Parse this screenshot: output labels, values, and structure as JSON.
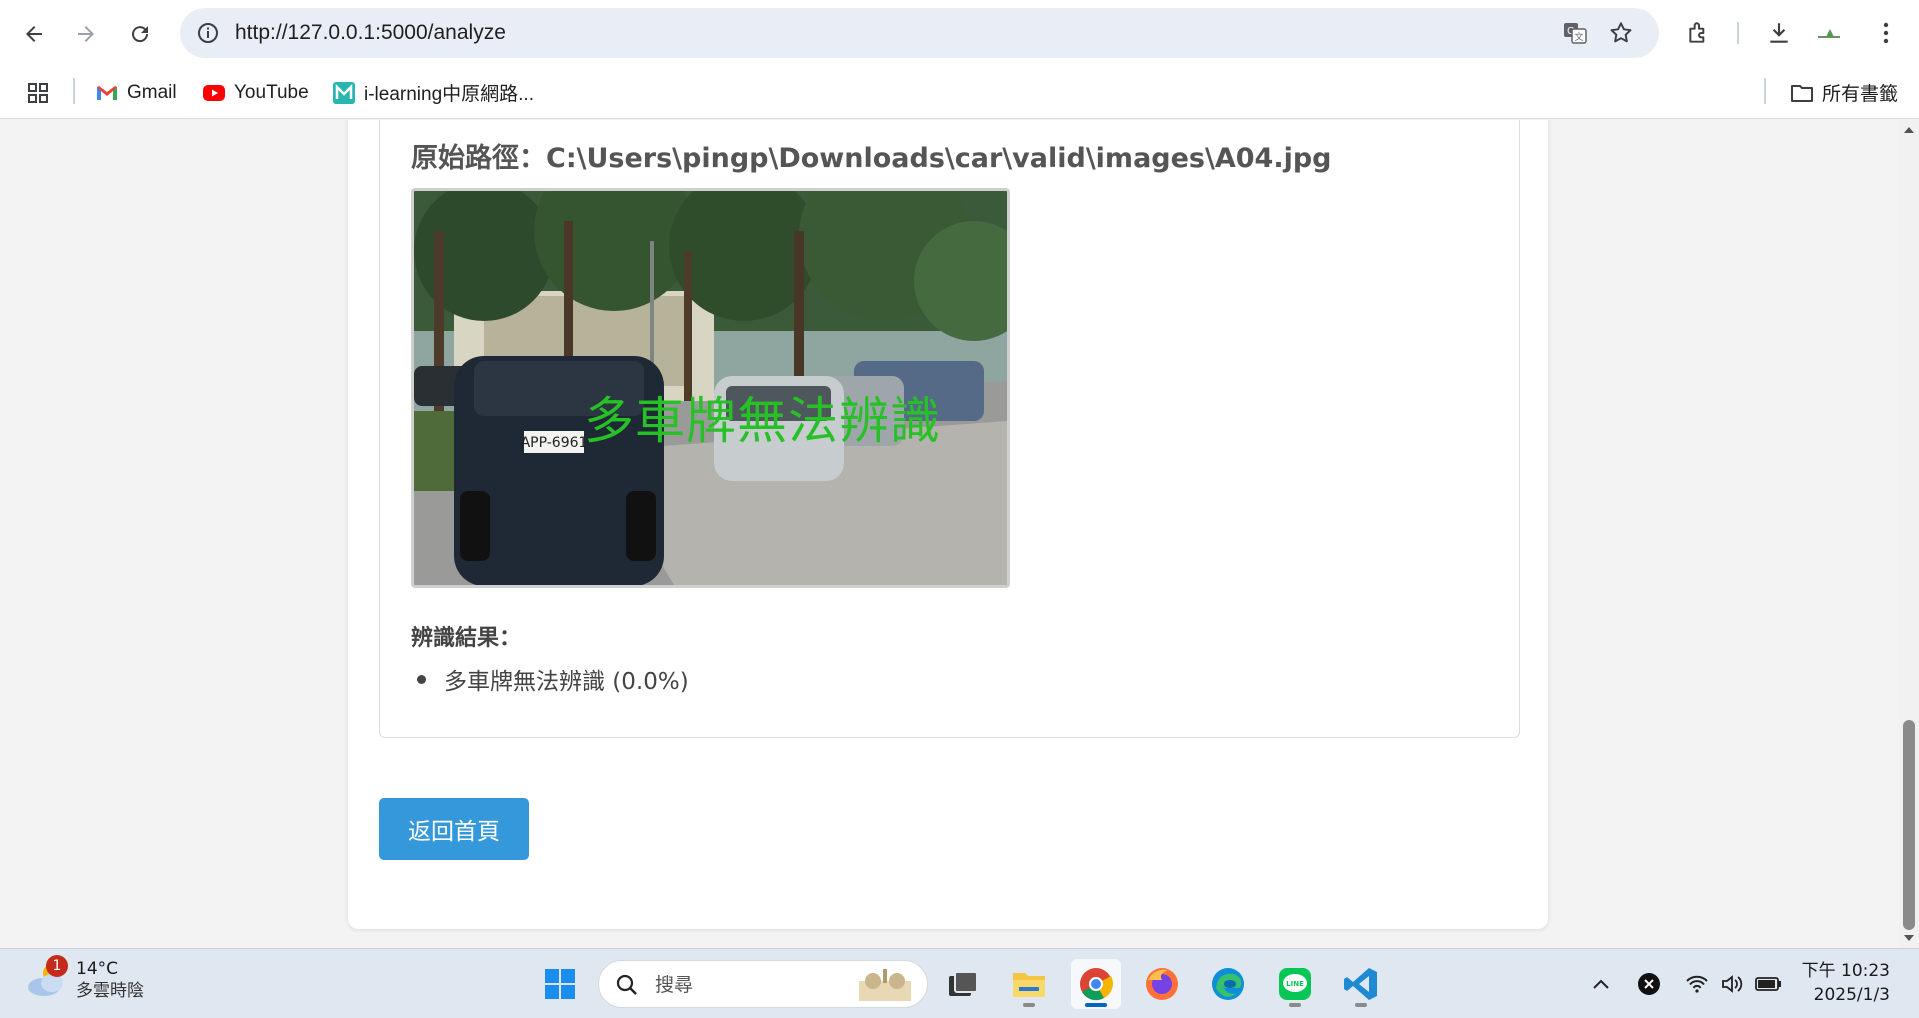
{
  "browser": {
    "url": "http://127.0.0.1:5000/analyze",
    "bookmarks": [
      {
        "label": "Gmail",
        "icon": "gmail-icon"
      },
      {
        "label": "YouTube",
        "icon": "youtube-icon"
      },
      {
        "label": "i-learning中原網路...",
        "icon": "ilearning-icon"
      }
    ],
    "all_bookmarks_label": "所有書籤"
  },
  "page": {
    "path_label": "原始路徑：C:\\Users\\pingp\\Downloads\\car\\valid\\images\\A04.jpg",
    "image_overlay_text": "多車牌無法辨識",
    "result_title": "辨識結果：",
    "results": [
      "多車牌無法辨識 (0.0%)"
    ],
    "back_button": "返回首頁",
    "plate_text": "APP-6961"
  },
  "taskbar": {
    "weather_temp": "14°C",
    "weather_cond": "多雲時陰",
    "weather_badge": "1",
    "search_placeholder": "搜尋",
    "time": "下午 10:23",
    "date": "2025/1/3"
  },
  "colors": {
    "accent_button": "#3498db",
    "overlay_text": "#27c127",
    "taskbar_active": "#0067c0"
  }
}
